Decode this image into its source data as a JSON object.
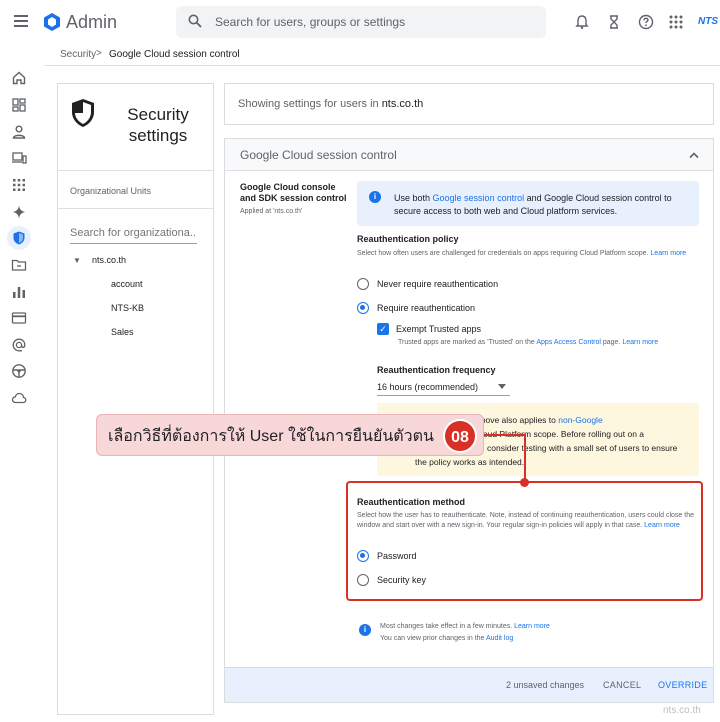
{
  "app": {
    "title": "Admin",
    "brand": "NTS"
  },
  "search": {
    "placeholder": "Search for users, groups or settings"
  },
  "breadcrumb": {
    "parent": "Security",
    "separator": ">",
    "current": "Google Cloud session control"
  },
  "sidebar_card": {
    "title": "Security settings",
    "ou_header": "Organizational Units",
    "ou_search_placeholder": "Search for organizationa...",
    "root": "nts.co.th",
    "children": [
      "account",
      "NTS-KB",
      "Sales"
    ]
  },
  "showing": {
    "prefix": "Showing settings for users in ",
    "domain": "nts.co.th"
  },
  "panel": {
    "title": "Google Cloud session control",
    "setting_name": "Google Cloud console and SDK session control",
    "applied_at": "Applied at 'nts.co.th'",
    "info": {
      "pre": "Use both ",
      "link": "Google session control",
      "post": " and Google Cloud session control to secure access to both web and Cloud platform services."
    },
    "policy": {
      "title": "Reauthentication policy",
      "desc": "Select how often users are challenged for credentials on apps requiring Cloud Platform scope.",
      "learn_more": "Learn more",
      "options": [
        "Never require reauthentication",
        "Require reauthentication"
      ],
      "selected": "Require reauthentication"
    },
    "exempt": {
      "label": "Exempt Trusted apps",
      "checked": true,
      "desc_pre": "Trusted apps are marked as 'Trusted' on the ",
      "desc_link": "Apps Access Control",
      "desc_mid": " page. ",
      "desc_learn": "Learn more"
    },
    "frequency": {
      "title": "Reauthentication frequency",
      "value": "16 hours (recommended)"
    },
    "warning": {
      "line1_pre": "ication policy above also applies to ",
      "line1_link": "non-Google",
      "line2": "loud Platform scope. Before rolling out on a",
      "line3": "consider testing with a small set of users to ensure",
      "line4": "the policy works as intended."
    },
    "method": {
      "title": "Reauthentication method",
      "desc": "Select how the user has to reauthenticate. Note, instead of continuing reauthentication, users could close the window and start over with a new sign-in. Your regular sign-in policies will apply in that case.",
      "learn_more": "Learn more",
      "options": [
        "Password",
        "Security key"
      ],
      "selected": "Password"
    },
    "notes": {
      "line1": "Most changes take effect in a few minutes.",
      "line1_link": "Learn more",
      "line2": "You can view prior changes in the",
      "line2_link": "Audit log"
    },
    "actions": {
      "unsaved": "2 unsaved changes",
      "cancel": "CANCEL",
      "override": "OVERRIDE"
    }
  },
  "callout": {
    "text": "เลือกวิธีที่ต้องการให้ User ใช้ในการยืนยันตัวตน",
    "step": "08"
  },
  "watermark": "nts.co.th",
  "colors": {
    "accent": "#1a73e8",
    "annotation": "#d93025",
    "callout_bg": "#f8d7d9",
    "warning_bg": "#fef7e0",
    "info_bg": "#e8f0fe"
  }
}
